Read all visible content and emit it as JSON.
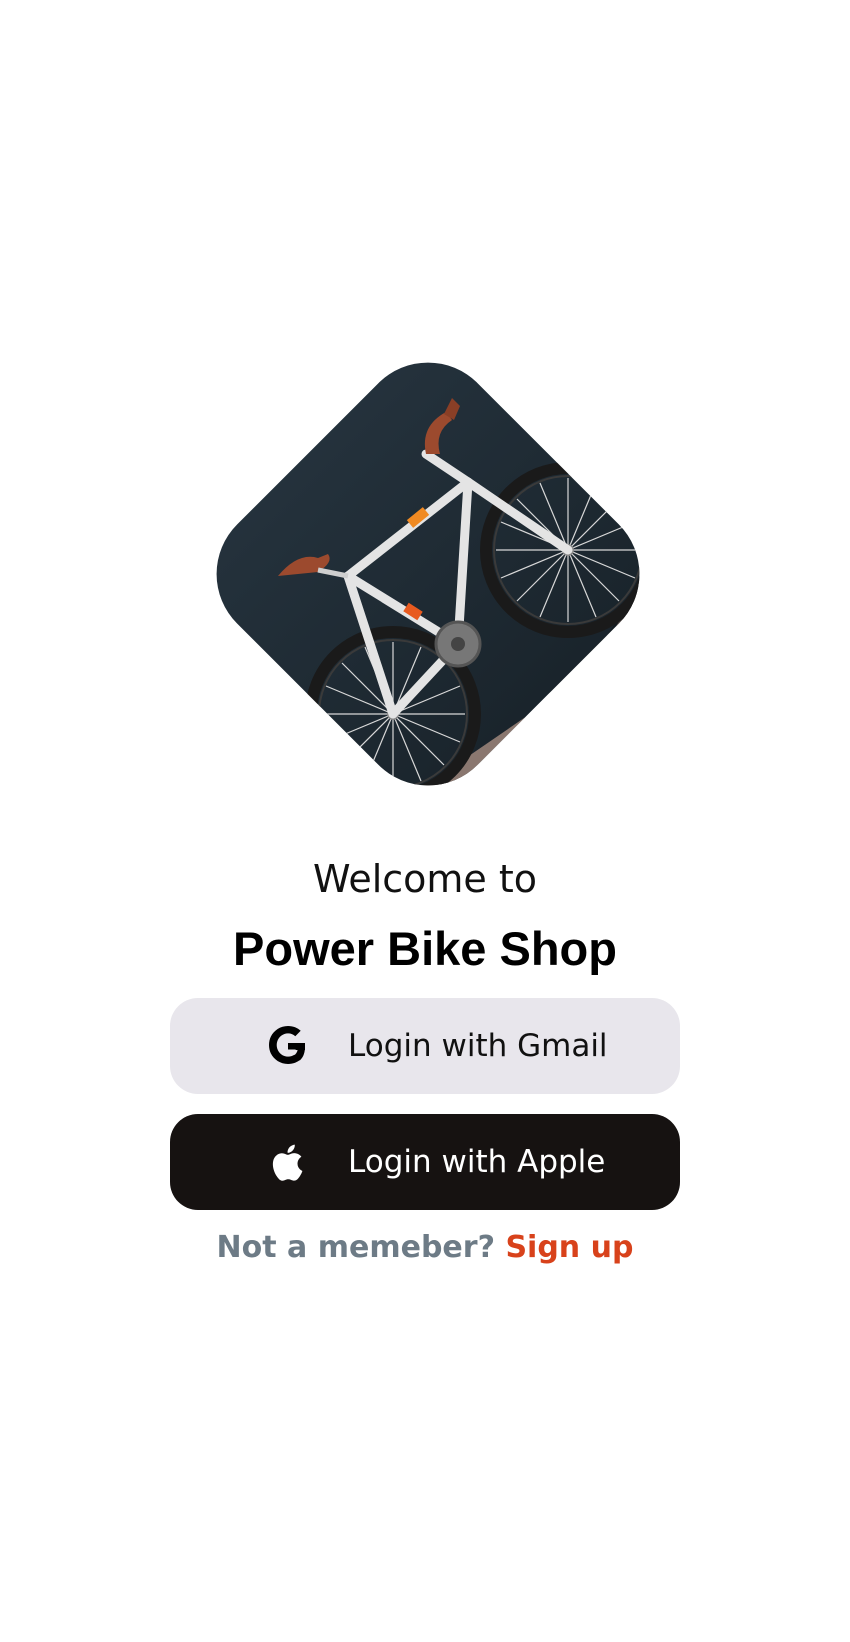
{
  "welcome": {
    "line1": "Welcome to",
    "shop_name": "Power Bike Shop"
  },
  "buttons": {
    "gmail": {
      "label": "Login with Gmail",
      "icon": "google-icon"
    },
    "apple": {
      "label": "Login with Apple",
      "icon": "apple-icon"
    }
  },
  "signup": {
    "prompt": "Not a memeber?",
    "link": "Sign up"
  },
  "hero": {
    "description_icon": "bicycle-image"
  },
  "colors": {
    "gmail_button_bg": "#e8e6ec",
    "apple_button_bg": "#161211",
    "signup_link": "#d8421b",
    "signup_prompt": "#6d7b86"
  }
}
